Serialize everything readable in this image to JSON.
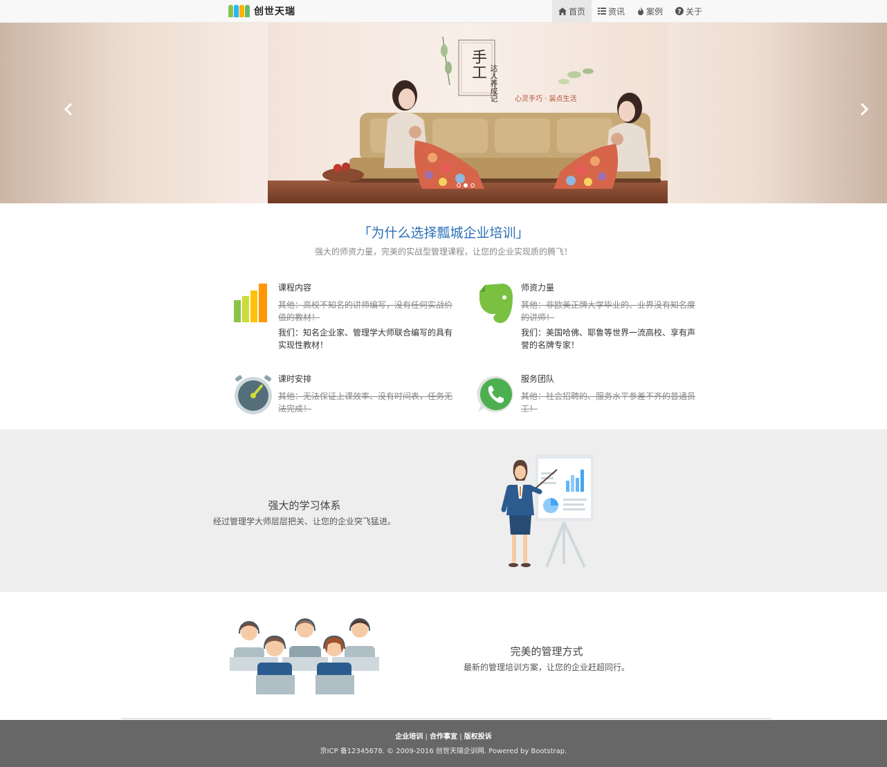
{
  "navbar": {
    "brand": "创世天瑞",
    "logo_colors": [
      "#4caf50",
      "#2196f3",
      "#ff9800",
      "#e91e63"
    ],
    "items": [
      {
        "label": "首页",
        "icon": "home-icon",
        "active": true
      },
      {
        "label": "资讯",
        "icon": "list-icon",
        "active": false
      },
      {
        "label": "案例",
        "icon": "fire-icon",
        "active": false
      },
      {
        "label": "关于",
        "icon": "question-circle-icon",
        "active": false
      }
    ]
  },
  "carousel": {
    "banner_title": "手工",
    "banner_vertical": "达人养成记",
    "banner_slogan": "心灵手巧 · 装点生活",
    "prev_icon": "chevron-left-icon",
    "next_icon": "chevron-right-icon",
    "active_slide": 2,
    "slide_count": 3
  },
  "why": {
    "title": "「为什么选择瓢城企业培训」",
    "subtitle": "强大的师资力量，完美的实战型管理课程，让您的企业实现质的腾飞！",
    "features": [
      {
        "title": "课程内容",
        "icon": "bar-chart-icon",
        "other": "其他：高校不知名的讲师编写，没有任何实战价值的教材！",
        "ours": "我们：知名企业家、管理学大师联合编写的具有实现性教材！"
      },
      {
        "title": "师资力量",
        "icon": "evernote-elephant-icon",
        "other": "其他：非欧美正牌大学毕业的、业界没有知名度的讲师！",
        "ours": "我们：美国哈佛、耶鲁等世界一流高校、享有声誉的名牌专家！"
      },
      {
        "title": "课时安排",
        "icon": "stopwatch-icon",
        "other": "其他：无法保证上课效率、没有时间表，任务无法完成！",
        "ours": ""
      },
      {
        "title": "服务团队",
        "icon": "whatsapp-phone-icon",
        "other": "其他：社会招聘的、服务水平参差不齐的普通员工！",
        "ours": ""
      }
    ]
  },
  "learning": {
    "title": "强大的学习体系",
    "text": "经过管理学大师层层把关、让您的企业突飞猛进。",
    "illustration": "presenter-whiteboard-illustration"
  },
  "management": {
    "title": "完美的管理方式",
    "text": "最新的管理培训方案，让您的企业赶超同行。",
    "illustration": "call-center-team-illustration"
  },
  "footer": {
    "links": [
      "企业培训",
      "合作事宜",
      "版权投诉"
    ],
    "separator": "|",
    "copyright": "京ICP 备12345678. © 2009-2016 创世天瑞企训网. Powered by Bootstrap."
  },
  "colors": {
    "title_blue": "#2a6fb7",
    "footer_bg": "#676767",
    "learn_bg": "#eeeeee"
  }
}
